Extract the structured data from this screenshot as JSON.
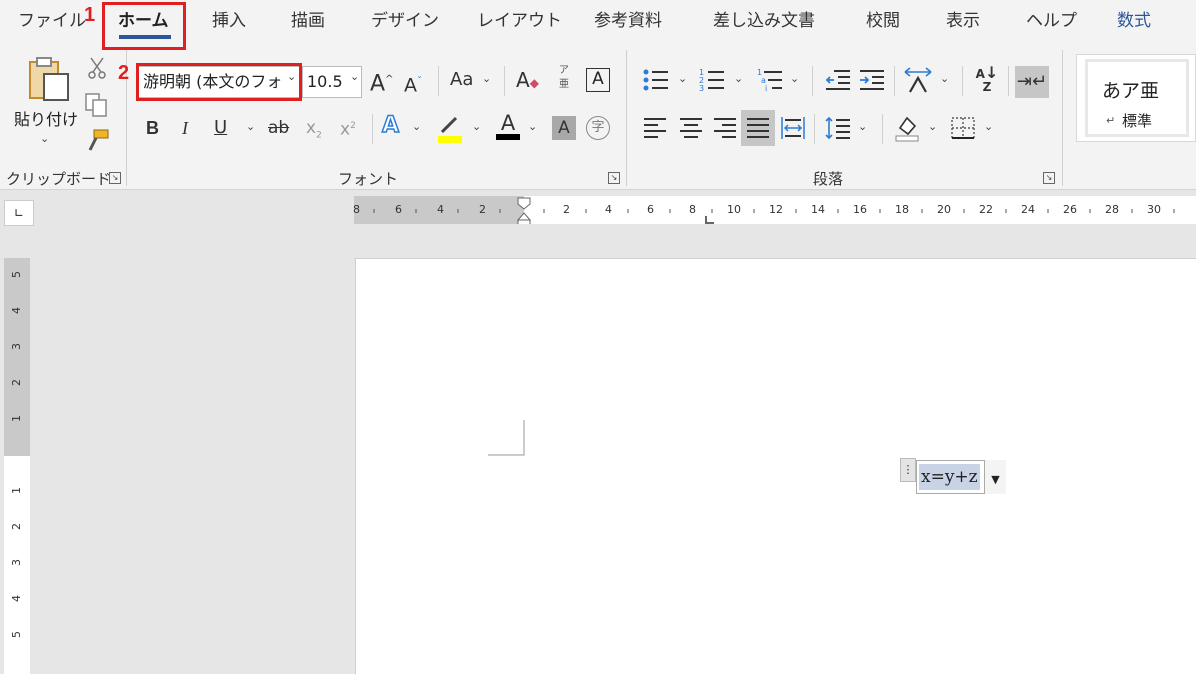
{
  "tabs": {
    "file": "ファイル",
    "home": "ホーム",
    "insert": "挿入",
    "draw": "描画",
    "design": "デザイン",
    "layout": "レイアウト",
    "references": "参考資料",
    "mailings": "差し込み文書",
    "review": "校閲",
    "view": "表示",
    "help": "ヘルプ",
    "equation": "数式"
  },
  "callouts": {
    "one": "1",
    "two": "2"
  },
  "clipboard": {
    "paste_label": "貼り付け",
    "group_label": "クリップボード"
  },
  "font": {
    "name_value": "游明朝 (本文のフォ",
    "size_value": "10.5",
    "group_label": "フォント",
    "bold": "B",
    "italic": "I",
    "underline": "U",
    "strike": "ab",
    "case": "Aa",
    "ruby_top": "ア",
    "ruby_bottom": "亜",
    "border_char": "A",
    "enclosed_char": "字"
  },
  "paragraph": {
    "group_label": "段落"
  },
  "styles": {
    "preview": "あア亜",
    "normal": "標準"
  },
  "ruler": {
    "h_left": [
      "8",
      "6",
      "4",
      "2"
    ],
    "h_right": [
      "2",
      "4",
      "6",
      "8",
      "10",
      "12",
      "14",
      "16",
      "18",
      "20",
      "22",
      "24",
      "26",
      "28",
      "30"
    ],
    "v_top": [
      "5",
      "4",
      "3",
      "2",
      "1"
    ],
    "v_bottom": [
      "1",
      "2",
      "3",
      "4",
      "5"
    ]
  },
  "document": {
    "equation": "x=y+z"
  },
  "colors": {
    "accent": "#2b579a",
    "callout": "#e02020",
    "highlight": "#ffff00",
    "font_color": "#000000"
  }
}
